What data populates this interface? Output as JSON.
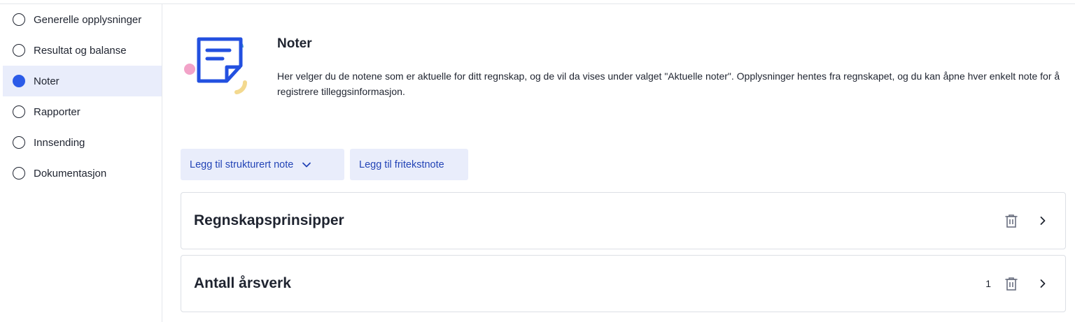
{
  "sidebar": {
    "items": [
      {
        "label": "Generelle opplysninger",
        "active": false
      },
      {
        "label": "Resultat og balanse",
        "active": false
      },
      {
        "label": "Noter",
        "active": true
      },
      {
        "label": "Rapporter",
        "active": false
      },
      {
        "label": "Innsending",
        "active": false
      },
      {
        "label": "Dokumentasjon",
        "active": false
      }
    ]
  },
  "header": {
    "title": "Noter",
    "description": "Her velger du de notene som er aktuelle for ditt regnskap, og de vil da vises under valget \"Aktuelle noter\". Opplysninger hentes fra regnskapet, og du kan åpne hver enkelt note for å registrere tilleggsinformasjon."
  },
  "actions": {
    "add_structured_label": "Legg til strukturert note",
    "add_freetext_label": "Legg til fritekstnote"
  },
  "notes": [
    {
      "title": "Regnskapsprinsipper",
      "count": ""
    },
    {
      "title": "Antall årsverk",
      "count": "1"
    }
  ],
  "colors": {
    "accent": "#2b5be8",
    "button_bg": "#e9edfb",
    "button_text": "#2344b6",
    "text": "#1f2430",
    "border": "#dcdfe5"
  },
  "icons": {
    "radio_unchecked": "radio-empty-icon",
    "radio_checked": "radio-filled-icon",
    "chevron_down": "chevron-down-icon",
    "trash": "trash-icon",
    "chevron_right": "chevron-right-icon",
    "illustration": "note-document-illustration"
  }
}
